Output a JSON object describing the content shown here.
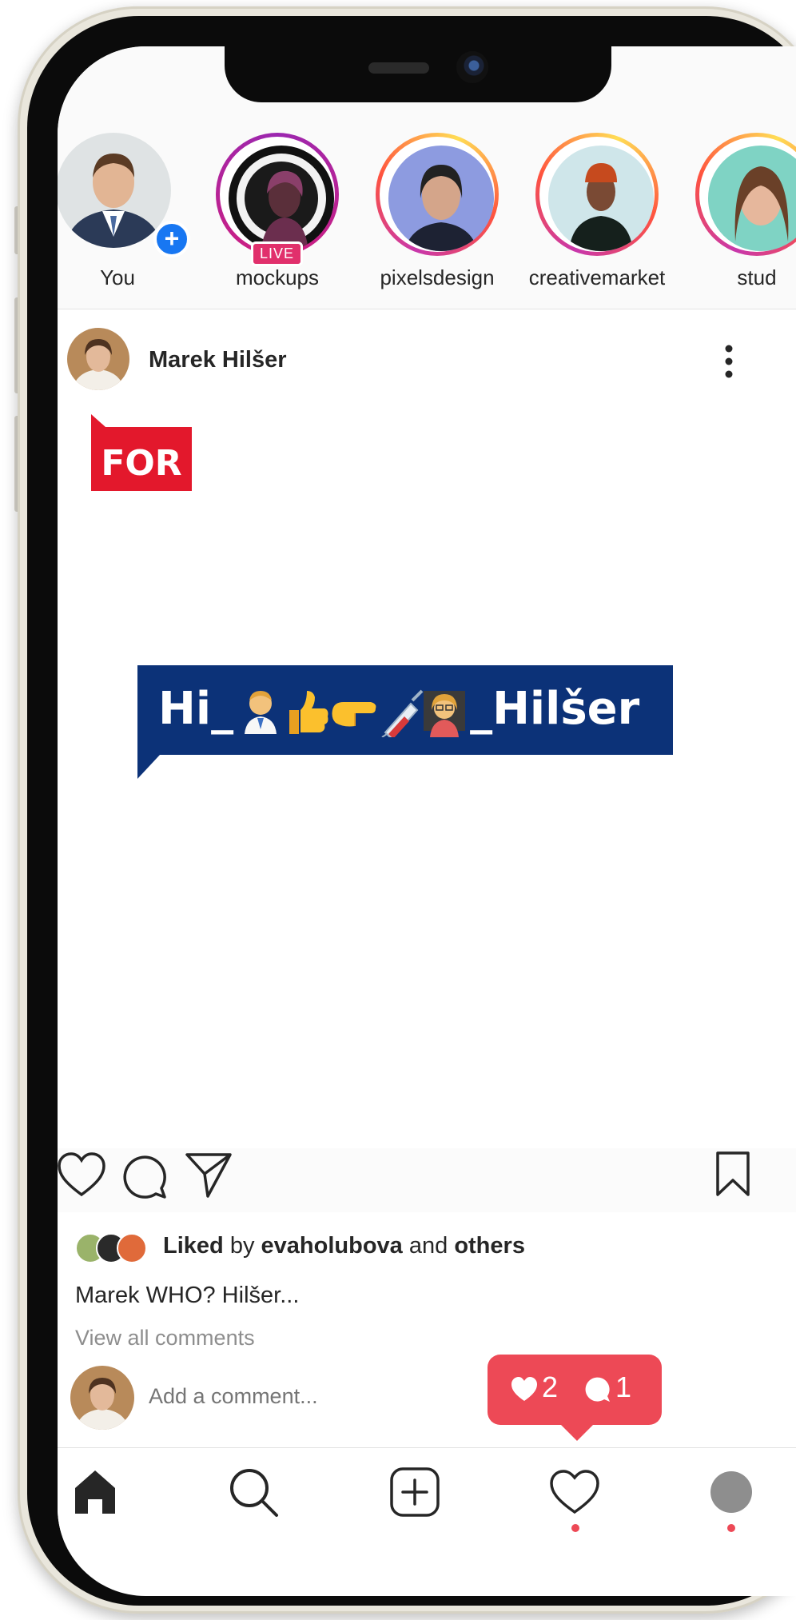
{
  "stories": [
    {
      "username": "You",
      "badge": "plus",
      "ring": "none"
    },
    {
      "username": "mockups",
      "badge": "LIVE",
      "ring": "purple"
    },
    {
      "username": "pixelsdesign",
      "badge": "",
      "ring": "gradient"
    },
    {
      "username": "creativemarket",
      "badge": "",
      "ring": "gradient"
    },
    {
      "username": "stud",
      "badge": "",
      "ring": "gradient"
    }
  ],
  "live_label": "LIVE",
  "post": {
    "author": "Marek Hilšer",
    "image": {
      "tag": "FOR",
      "banner_prefix": "Hi_",
      "banner_suffix": "_Hilšer",
      "tag_color": "#e3182c",
      "banner_color": "#0c3278"
    },
    "likes": {
      "liked_word": "Liked",
      "by_word": "by",
      "user": "evaholubova",
      "and_word": "and",
      "others_word": "others"
    },
    "caption": "Marek WHO? Hilšer...",
    "view_comments": "View all comments",
    "comment_placeholder": "Add a comment..."
  },
  "notification": {
    "likes": "2",
    "comments": "1",
    "color": "#ed4956"
  },
  "icons": {
    "actions": [
      "heart-icon",
      "comment-icon",
      "share-icon",
      "bookmark-icon"
    ],
    "nav": [
      "home-icon",
      "search-icon",
      "add-post-icon",
      "activity-heart-icon",
      "profile-avatar"
    ]
  }
}
